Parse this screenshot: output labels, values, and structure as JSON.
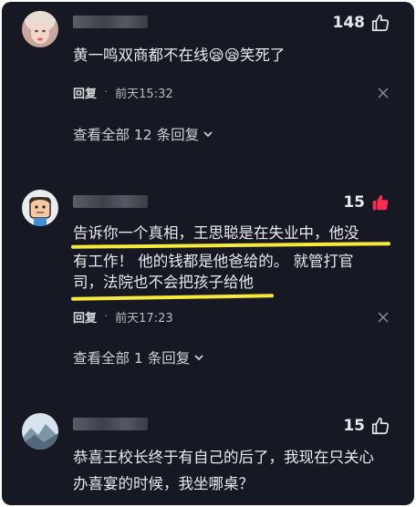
{
  "comments": [
    {
      "text": "黄一鸣双商都不在线😪😪笑死了",
      "likes": "148",
      "liked": false,
      "reply_label": "回复",
      "time": "前天15:32",
      "view_replies": "查看全部 12 条回复"
    },
    {
      "text_line1": "告诉你一个真相，王思聪是在失业中，他没",
      "text_line2": "有工作！ 他的钱都是他爸给的。 就管打官",
      "text_line3": "司，法院也不会把孩子给他",
      "likes": "15",
      "liked": true,
      "reply_label": "回复",
      "time": "前天17:23",
      "view_replies": "查看全部 1 条回复"
    },
    {
      "text_line1": "恭喜王校长终于有自己的后了，我现在只关心",
      "text_line2": "办喜宴的时候，我坐哪桌？",
      "likes": "15",
      "liked": false
    }
  ],
  "colors": {
    "background": "#161823",
    "liked_heart": "#fe2c55",
    "highlight_underline": "#f6ea3b"
  }
}
